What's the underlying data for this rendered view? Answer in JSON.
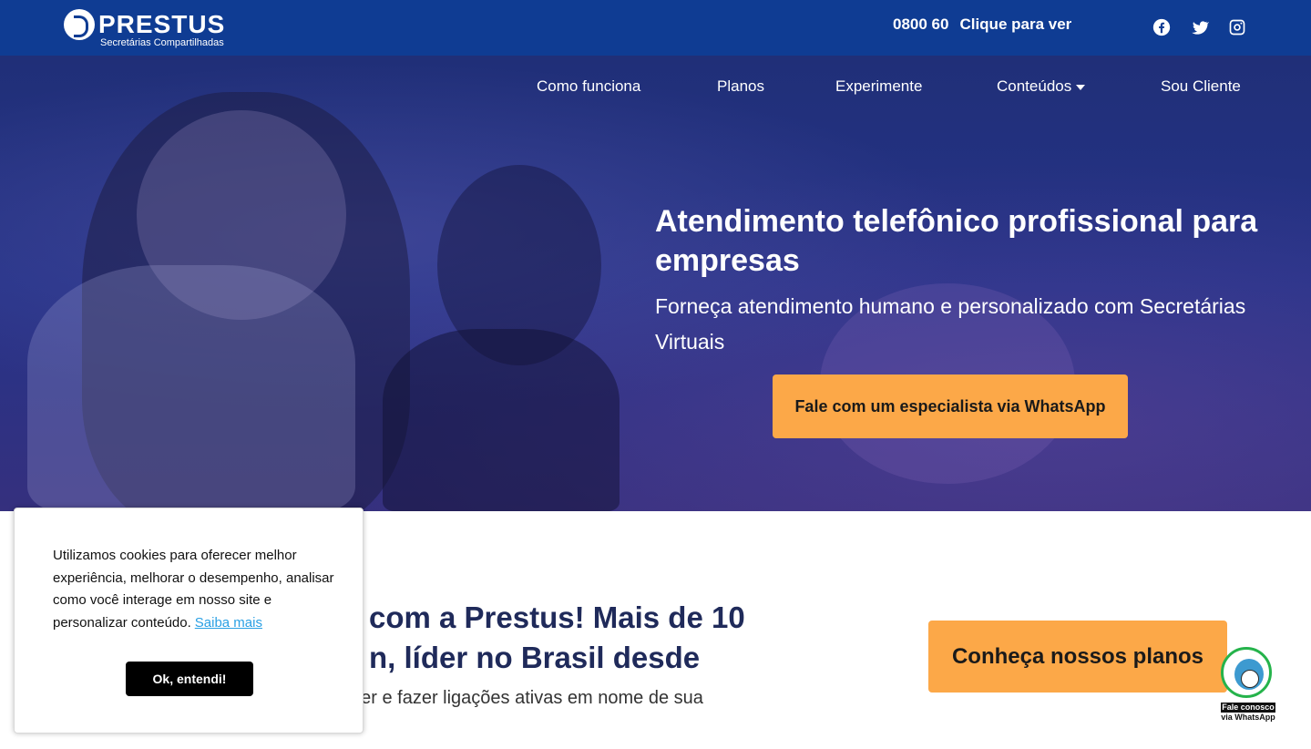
{
  "header": {
    "logo": {
      "name": "PRESTUS",
      "tagline": "Secretárias Compartilhadas"
    },
    "phone": {
      "number": "0800 60",
      "reveal_label": "Clique para ver"
    },
    "social": [
      "facebook-icon",
      "twitter-icon",
      "instagram-icon"
    ]
  },
  "nav": {
    "items": [
      {
        "label": "Como funciona"
      },
      {
        "label": "Planos"
      },
      {
        "label": "Experimente"
      },
      {
        "label": "Conteúdos"
      },
      {
        "label": "Sou Cliente"
      }
    ]
  },
  "hero": {
    "title": "Atendimento telefônico profissional para empresas",
    "subtitle": "Forneça atendimento humano e personalizado com Secretárias Virtuais",
    "cta": "Fale com um especialista via WhatsApp"
  },
  "section": {
    "title_visible": "com a Prestus! Mais de 10\nn, líder no Brasil desde",
    "text_visible": "der e fazer ligações ativas em nome de sua",
    "cta": "Conheça nossos planos"
  },
  "whatsapp_float": {
    "line1": "Fale conosco",
    "line2": "via WhatsApp"
  },
  "cookie": {
    "text": "Utilizamos cookies para oferecer melhor experiência, melhorar o desempenho, analisar como você interage em nosso site e personalizar conteúdo.",
    "link": "Saiba mais",
    "button": "Ok, entendi!"
  },
  "colors": {
    "topbar": "#0f3c93",
    "accent": "#fca848",
    "heading": "#1f2a5a",
    "link": "#2aa0e4",
    "whatsapp": "#25b34b"
  }
}
